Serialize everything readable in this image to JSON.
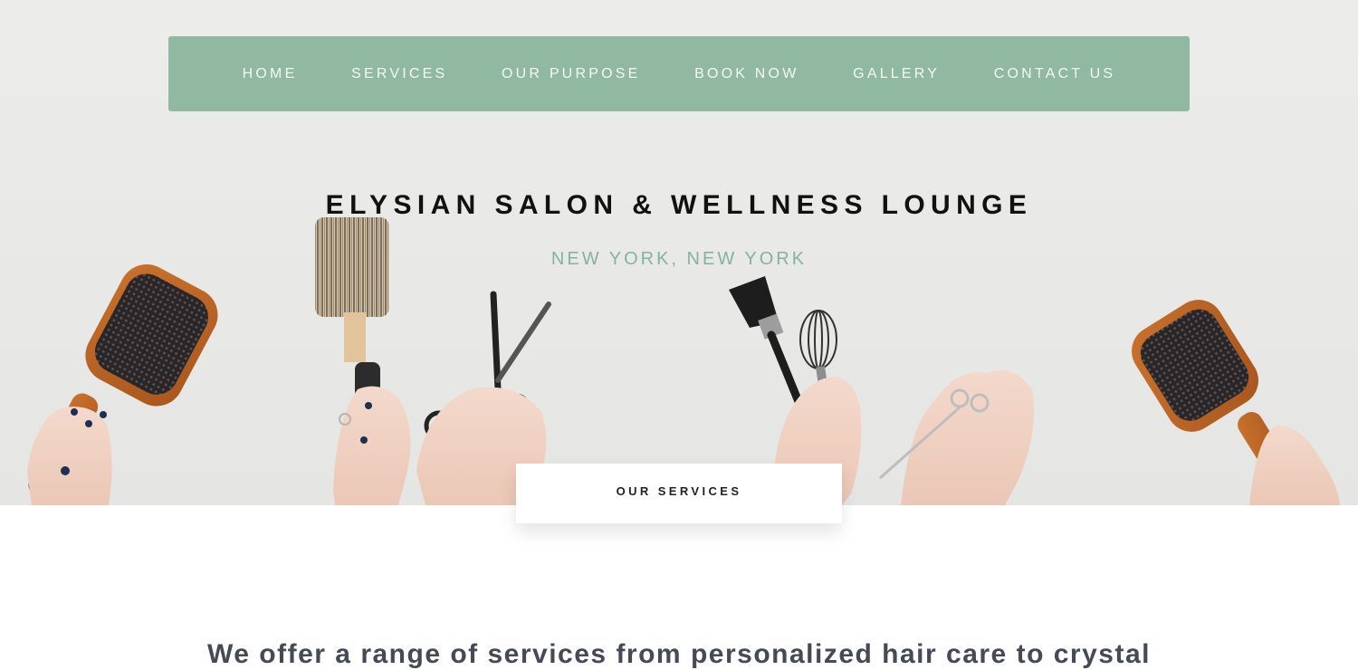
{
  "nav": {
    "items": [
      {
        "label": "HOME"
      },
      {
        "label": "SERVICES"
      },
      {
        "label": "OUR PURPOSE"
      },
      {
        "label": "BOOK NOW"
      },
      {
        "label": "GALLERY"
      },
      {
        "label": "CONTACT US"
      }
    ]
  },
  "hero": {
    "title": "ELYSIAN SALON & WELLNESS LOUNGE",
    "location": "NEW YORK, NEW YORK",
    "image_subject": "hands-holding-salon-tools"
  },
  "services": {
    "tab_label": "OUR SERVICES",
    "intro": "We offer a range of services from personalized hair care to crystal"
  },
  "colors": {
    "accent": "#91b9a2",
    "location_text": "#86b39b",
    "title_text": "#111111",
    "body_text": "#454a55",
    "hero_background": "#e8e8e6"
  }
}
